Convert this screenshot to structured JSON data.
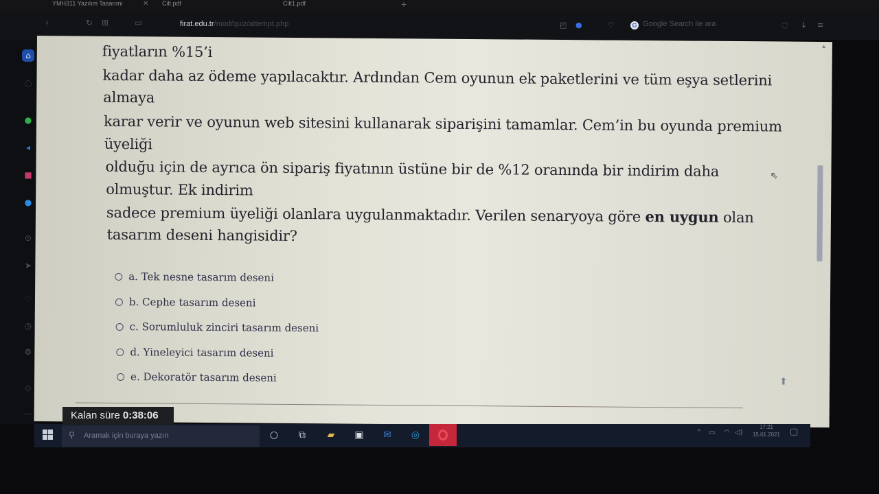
{
  "browser": {
    "tabs": [
      {
        "label": "YMH311 Yazılım Tasarımı"
      },
      {
        "label": "Cilt.pdf"
      },
      {
        "label": "Cilt1.pdf"
      }
    ],
    "url_host": "firat.edu.tr",
    "url_path": "/mod/quiz/attempt.php",
    "search_placeholder": "Google Search ile ara"
  },
  "question": {
    "lines": [
      "fiyatların %15’i",
      "kadar daha az ödeme yapılacaktır. Ardından Cem oyunun ek paketlerini ve tüm eşya setlerini",
      "almaya",
      "karar verir ve oyunun web sitesini kullanarak siparişini tamamlar. Cem’in bu oyunda premium",
      "üyeliği",
      "olduğu için de ayrıca ön sipariş fiyatının üstüne bir de %12 oranında bir indirim daha",
      "olmuştur. Ek indirim"
    ],
    "line8_before": "sadece premium üyeliği olanlara uygulanmaktadır. Verilen senaryoya göre ",
    "line8_bold": "en uygun",
    "line8_after": " olan",
    "line9": "tasarım deseni hangisidir?"
  },
  "options": [
    {
      "label": "a. Tek nesne tasarım deseni"
    },
    {
      "label": "b. Cephe tasarım deseni"
    },
    {
      "label": "c. Sorumluluk zinciri tasarım deseni"
    },
    {
      "label": "d. Yineleyici tasarım deseni"
    },
    {
      "label": "e. Dekoratör tasarım deseni"
    }
  ],
  "timer": {
    "label": "Kalan süre",
    "value": "0:38:06"
  },
  "taskbar": {
    "search_placeholder": "Aramak için buraya yazın",
    "time": "17:21",
    "date": "15.01.2021"
  }
}
